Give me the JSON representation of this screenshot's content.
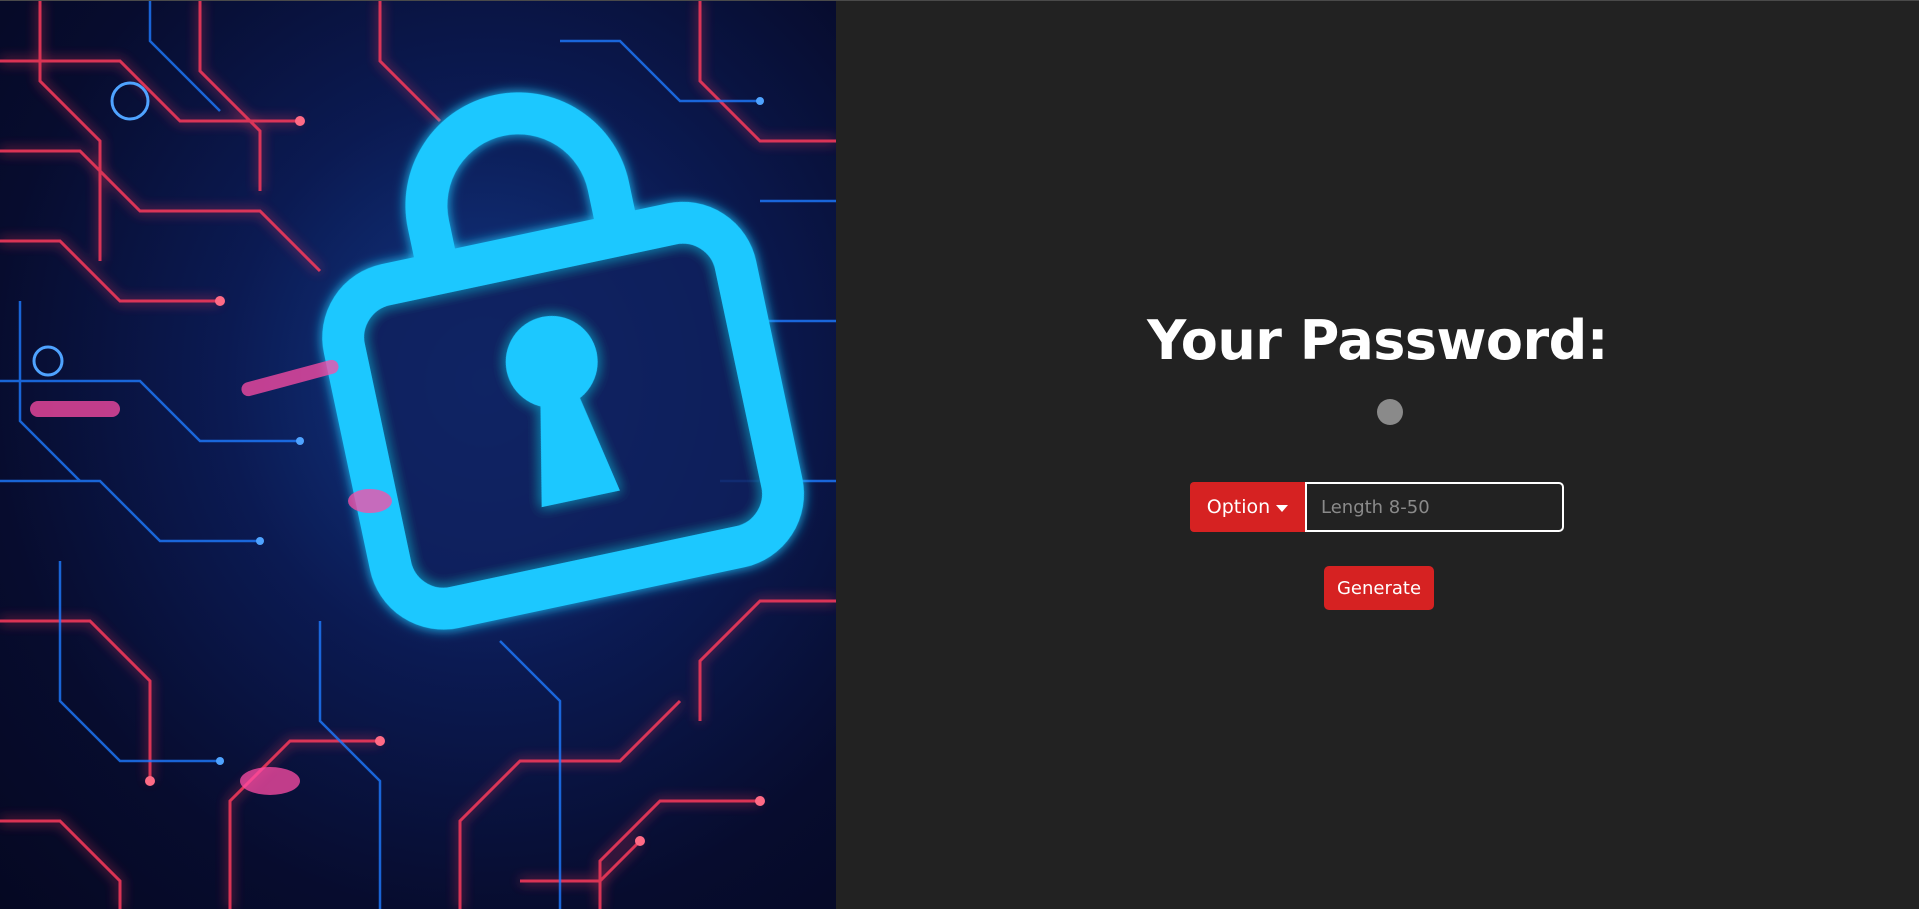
{
  "hero": {
    "image_name": "padlock-circuit-illustration",
    "colors": {
      "lock": "#1ec8ff",
      "circuit_red": "#ff3b5c",
      "circuit_blue": "#1e7bff",
      "background": "#0b1a52"
    }
  },
  "main": {
    "title": "Your Password:",
    "dropdown": {
      "label": "Option"
    },
    "length_input": {
      "placeholder": "Length 8-50",
      "value": ""
    },
    "generate_label": "Generate"
  },
  "colors": {
    "accent": "#d62222",
    "panel_background": "#222222",
    "spinner": "#8a8a8a"
  }
}
